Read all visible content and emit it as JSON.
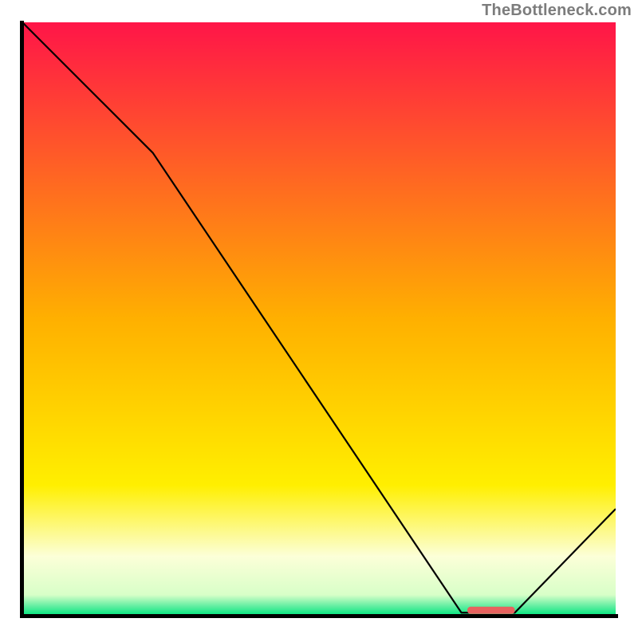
{
  "watermark": "TheBottleneck.com",
  "colors": {
    "top": "#ff1548",
    "mid": "#ffcf00",
    "lower_red_bright": "#fe2b56",
    "lower_red": "#fe2b56",
    "lower_yellow": "#ffea00",
    "lower_white": "#fffcea",
    "bottom_green": "#00e77e",
    "line": "#000000",
    "marker": "#e7625f",
    "axis": "#000000"
  },
  "chart_data": {
    "type": "line",
    "title": "",
    "xlabel": "",
    "ylabel": "",
    "x": [
      0,
      22,
      74,
      76,
      83,
      100
    ],
    "y": [
      100,
      78,
      0.5,
      0.5,
      0.5,
      18
    ],
    "xlim": [
      0,
      100
    ],
    "ylim": [
      0,
      100
    ],
    "marker_segment": {
      "x0": 75,
      "x1": 83,
      "y": 0.9
    },
    "gradient_stops": [
      {
        "offset": 0.0,
        "color": "#ff1548"
      },
      {
        "offset": 0.5,
        "color": "#ffb000"
      },
      {
        "offset": 0.78,
        "color": "#ffef00"
      },
      {
        "offset": 0.9,
        "color": "#fcffd8"
      },
      {
        "offset": 0.965,
        "color": "#d8ffc8"
      },
      {
        "offset": 0.985,
        "color": "#5bed9f"
      },
      {
        "offset": 1.0,
        "color": "#00e77e"
      }
    ]
  }
}
